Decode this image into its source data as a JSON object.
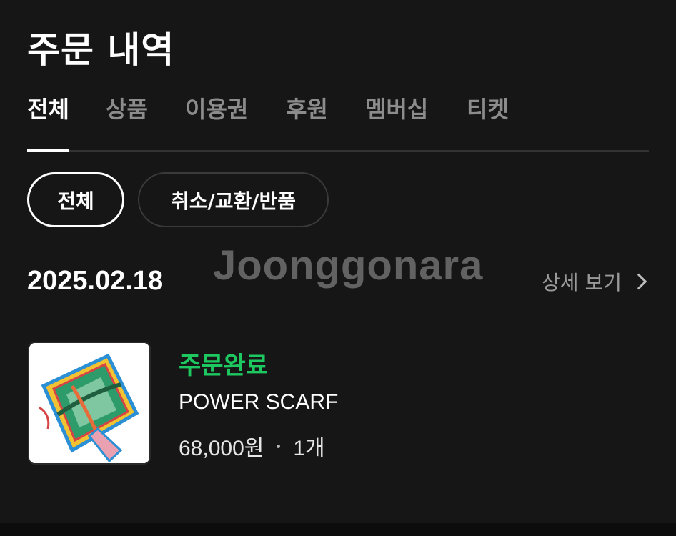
{
  "header": {
    "title": "주문 내역"
  },
  "tabs": [
    {
      "label": "전체",
      "active": true
    },
    {
      "label": "상품",
      "active": false
    },
    {
      "label": "이용권",
      "active": false
    },
    {
      "label": "후원",
      "active": false
    },
    {
      "label": "멤버십",
      "active": false
    },
    {
      "label": "티켓",
      "active": false
    }
  ],
  "filters": [
    {
      "label": "전체",
      "active": true
    },
    {
      "label": "취소/교환/반품",
      "active": false
    }
  ],
  "watermark": "Joonggonara",
  "order": {
    "date": "2025.02.18",
    "detail_label": "상세 보기",
    "status": "주문완료",
    "product_name": "POWER SCARF",
    "price": "68,000원",
    "quantity": "1개"
  },
  "colors": {
    "background": "#161616",
    "status_green": "#1ec860",
    "muted_text": "#8c8c8c"
  }
}
